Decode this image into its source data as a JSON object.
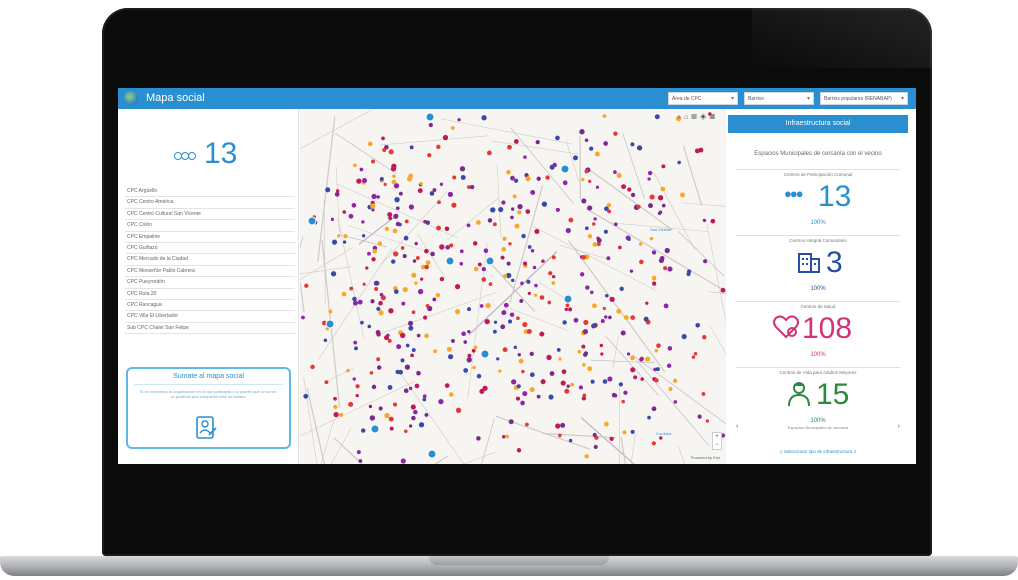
{
  "header": {
    "title": "Mapa social",
    "filters": [
      {
        "value": "Área de CPC"
      },
      {
        "value": "Barrios"
      },
      {
        "value": "Barrios populares (RENABAP)"
      }
    ]
  },
  "sidebar": {
    "total": "13",
    "cpc_items": [
      "CPC Argüello",
      "CPC Centro América",
      "CPC Centro Cultural San Vicente",
      "CPC Colón",
      "CPC Empalme",
      "CPC Guiñazú",
      "CPC Mercado de la Ciudad",
      "CPC Monseñor Pablo Cabrera",
      "CPC Pueyrredón",
      "CPC Ruta 20",
      "CPC Rancagua",
      "CPC Villa El Libertador",
      "Sub CPC Chalet San Felipe"
    ],
    "join_card": {
      "title": "Sumate al mapa social",
      "text": "Si no encontrás la organización en la que participás o si querés que se sume, te pedimos que completes este formulario"
    }
  },
  "map": {
    "tools": [
      "search-icon",
      "home-icon",
      "layers-icon",
      "basemap-icon",
      "grid-icon"
    ],
    "places": [
      {
        "name": "San Vicente"
      },
      {
        "name": "Cordoba"
      }
    ],
    "attribution": "Powered by Esri",
    "zoom_in": "+",
    "zoom_out": "−"
  },
  "panel": {
    "header": "Infraestructura social",
    "subtitle": "Espacios Municipales de cercanía con el vecino",
    "stats": [
      {
        "label": "Centros de Participación Comunal",
        "value": "13",
        "percent": "100%",
        "color": "#2a8fd1",
        "icon": "people-icon"
      },
      {
        "label": "Centros Integral Comunitario",
        "value": "3",
        "percent": "100%",
        "color": "#2b4ea2",
        "icon": "building-icon"
      },
      {
        "label": "Centros de Salud",
        "value": "108",
        "percent": "100%",
        "color": "#d6307a",
        "icon": "health-icon"
      },
      {
        "label": "Centros de Vida para Adultos Mayores",
        "value": "15",
        "percent": "100%",
        "color": "#2d8a3e",
        "icon": "elderly-icon"
      }
    ],
    "pager_label": "Espacios Municipales de cercanía",
    "link": "¡! Seleccionar tipo de infraestructura ¡!"
  }
}
